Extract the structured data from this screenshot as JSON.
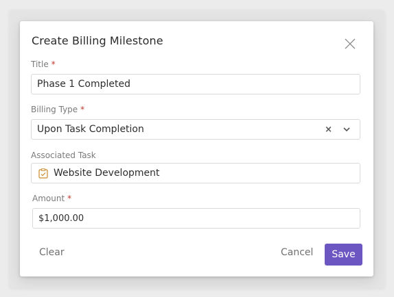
{
  "dialog": {
    "title": "Create Billing Milestone",
    "close_icon": "close-icon"
  },
  "fields": {
    "title": {
      "label": "Title",
      "required_mark": "*",
      "value": "Phase 1 Completed"
    },
    "billing_type": {
      "label": "Billing Type",
      "required_mark": "*",
      "value": "Upon Task Completion",
      "clear_glyph": "×",
      "clear_icon": "clear-icon",
      "dropdown_icon": "chevron-down-icon"
    },
    "associated_task": {
      "label": "Associated Task",
      "value": "Website Development",
      "task_icon": "task-icon"
    },
    "amount": {
      "label": "Amount",
      "required_mark": "*",
      "value": "$1,000.00"
    }
  },
  "footer": {
    "clear_label": "Clear",
    "cancel_label": "Cancel",
    "save_label": "Save"
  },
  "colors": {
    "primary": "#6c56c2",
    "required": "#c0392b",
    "border": "#d9d9d9",
    "label": "#7a7a7a"
  }
}
